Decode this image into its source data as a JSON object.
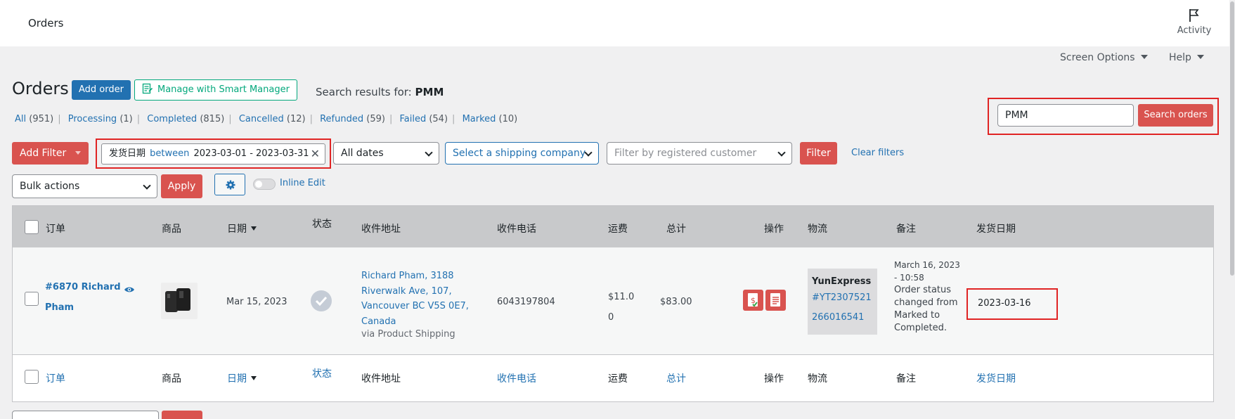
{
  "topbar": {
    "title": "Orders",
    "activity_label": "Activity"
  },
  "screen_options": {
    "label": "Screen Options",
    "help_label": "Help"
  },
  "page": {
    "title": "Orders",
    "add_order_label": "Add order",
    "smart_manager_label": "Manage with Smart Manager",
    "search_results_prefix": "Search results for:",
    "search_term": "PMM"
  },
  "views": [
    {
      "label": "All",
      "count": "(951)"
    },
    {
      "label": "Processing",
      "count": "(1)"
    },
    {
      "label": "Completed",
      "count": "(815)"
    },
    {
      "label": "Cancelled",
      "count": "(12)"
    },
    {
      "label": "Refunded",
      "count": "(59)"
    },
    {
      "label": "Failed",
      "count": "(54)"
    },
    {
      "label": "Marked",
      "count": "(10)"
    }
  ],
  "search": {
    "value": "PMM",
    "button_label": "Search orders"
  },
  "filters": {
    "add_filter_label": "Add Filter",
    "chip_field": "发货日期",
    "chip_operator": "between",
    "chip_value": "2023-03-01 - 2023-03-31",
    "chip_remove": "✕",
    "dates_select": "All dates",
    "shipping_select": "Select a shipping company",
    "customer_placeholder": "Filter by registered customer",
    "filter_button": "Filter",
    "clear_label": "Clear filters"
  },
  "bulk": {
    "select_label": "Bulk actions",
    "apply_label": "Apply",
    "inline_edit_label": "Inline Edit"
  },
  "table": {
    "columns": {
      "order": "订单",
      "product": "商品",
      "date": "日期",
      "status": "状态",
      "address": "收件地址",
      "phone": "收件电话",
      "shipping_fee": "运费",
      "total": "总计",
      "actions": "操作",
      "logistics": "物流",
      "notes": "备注",
      "ship_date": "发货日期"
    },
    "row": {
      "order_link": "#6870 Richard Pham",
      "date": "Mar 15, 2023",
      "address": "Richard Pham, 3188 Riverwalk Ave, 107, Vancouver BC V5S 0E7, Canada",
      "address_via": "via Product Shipping",
      "phone": "6043197804",
      "shipping_fee_line1": "$11.0",
      "shipping_fee_line2": "0",
      "total": "$83.00",
      "logistics_carrier": "YunExpress",
      "tracking_line1": "#YT2307521",
      "tracking_line2": "266016541",
      "note_time": "March 16, 2023 - 10:58",
      "note_text": "Order status changed from Marked to Completed.",
      "ship_date": "2023-03-16"
    }
  },
  "colors": {
    "primary": "#2271b1",
    "danger": "#d9534f",
    "smart_manager": "#03a87c",
    "highlight_border": "#e02424",
    "header_bg": "#c8c9cb"
  }
}
